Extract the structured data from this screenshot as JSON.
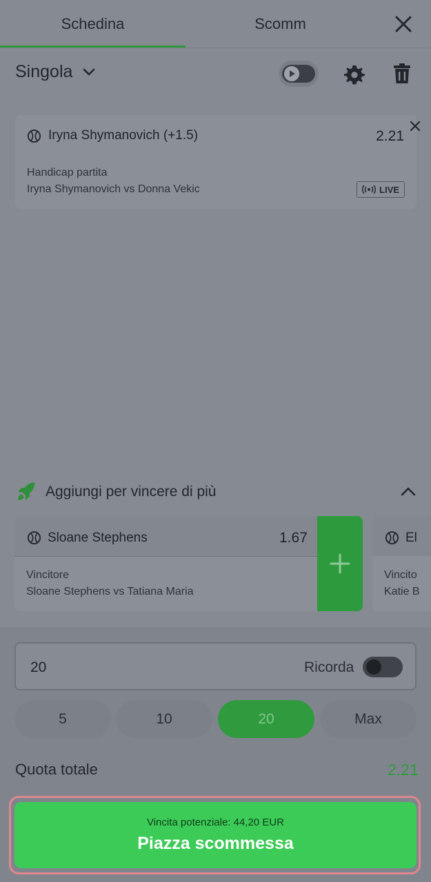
{
  "tabs": [
    {
      "label": "Schedina",
      "active": true
    },
    {
      "label": "Scomm",
      "active": false
    }
  ],
  "header": {
    "mode_label": "Singola"
  },
  "bet": {
    "selection": "Iryna Shymanovich (+1.5)",
    "odds": "2.21",
    "market": "Handicap partita",
    "event": "Iryna Shymanovich vs Donna Vekic",
    "live_label": "LIVE"
  },
  "add_more": {
    "title": "Aggiungi per vincere di più",
    "suggestions": [
      {
        "selection": "Sloane Stephens",
        "odds": "1.67",
        "market": "Vincitore",
        "event": "Sloane Stephens vs Tatiana Maria"
      },
      {
        "selection": "El",
        "market": "Vincito",
        "event": "Katie B"
      }
    ]
  },
  "stake": {
    "value": "20",
    "remember_label": "Ricorda",
    "remember_on": false,
    "quick_amounts": [
      "5",
      "10",
      "20",
      "Max"
    ],
    "selected_amount": "20"
  },
  "total_odds": {
    "label": "Quota totale",
    "value": "2.21"
  },
  "place_bet": {
    "potential_win": "Vincita potenziale: 44,20   EUR",
    "label": "Piazza scommessa"
  },
  "colors": {
    "accent_green": "#2f9a3e",
    "button_green": "#3ccb57",
    "highlight_red": "#e0868d"
  }
}
